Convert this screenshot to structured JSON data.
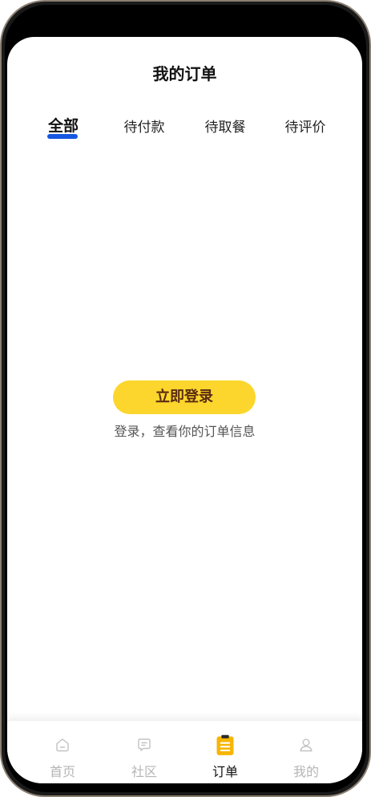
{
  "header": {
    "title": "我的订单"
  },
  "tabs": [
    {
      "label": "全部",
      "active": true
    },
    {
      "label": "待付款",
      "active": false
    },
    {
      "label": "待取餐",
      "active": false
    },
    {
      "label": "待评价",
      "active": false
    }
  ],
  "empty_state": {
    "login_button": "立即登录",
    "hint": "登录，查看你的订单信息"
  },
  "tabbar": {
    "items": [
      {
        "label": "首页",
        "icon": "home-icon",
        "active": false
      },
      {
        "label": "社区",
        "icon": "chat-icon",
        "active": false
      },
      {
        "label": "订单",
        "icon": "order-clipboard-icon",
        "active": true
      },
      {
        "label": "我的",
        "icon": "user-icon",
        "active": false
      }
    ]
  },
  "colors": {
    "accent_yellow": "#fcd62c",
    "tab_underline": "#1557e0",
    "active_icon": "#f7b500"
  }
}
